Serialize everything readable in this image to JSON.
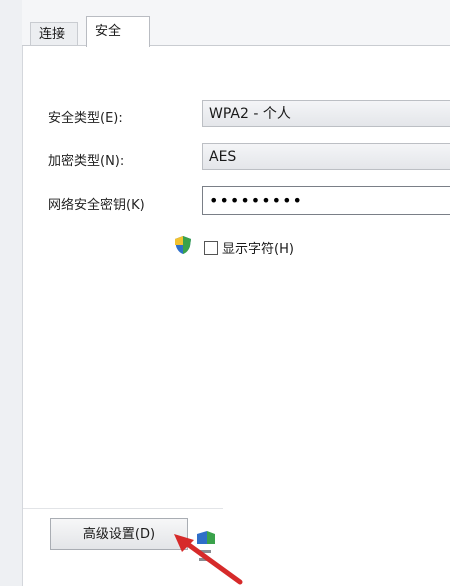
{
  "tabs": [
    {
      "label": "连接"
    },
    {
      "label": "安全"
    }
  ],
  "security_type": {
    "label": "安全类型(E):",
    "value": "WPA2 - 个人"
  },
  "encryption_type": {
    "label": "加密类型(N):",
    "value": "AES"
  },
  "network_key": {
    "label": "网络安全密钥(K)",
    "value": "•••••••••"
  },
  "show_characters": {
    "label": "显示字符(H)",
    "checked": false
  },
  "advanced_button": {
    "label": "高级设置(D)"
  },
  "colors": {
    "arrow": "#d62a2a",
    "shield_green": "#3aa24b",
    "shield_blue": "#2f6fc9"
  }
}
